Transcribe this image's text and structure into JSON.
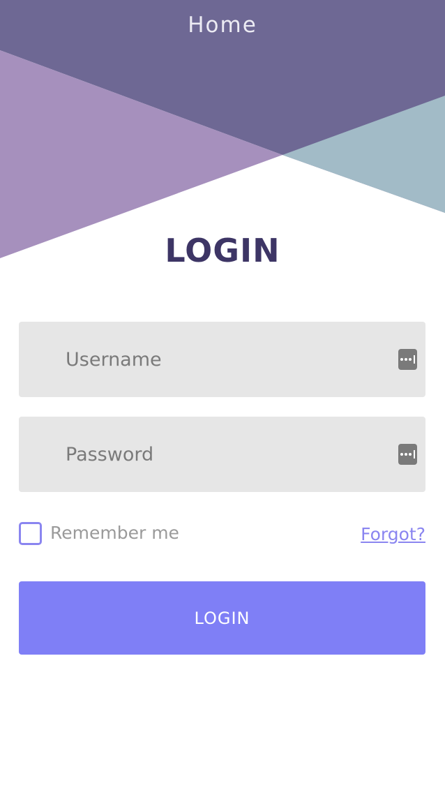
{
  "nav": {
    "title": "Home"
  },
  "page": {
    "title": "LOGIN"
  },
  "form": {
    "username": {
      "value": "",
      "placeholder": "Username",
      "icon": "password-manager-icon"
    },
    "password": {
      "value": "",
      "placeholder": "Password",
      "icon": "password-manager-icon"
    },
    "remember_label": "Remember me",
    "remember_checked": false,
    "forgot_label": "Forgot?",
    "submit_label": "LOGIN"
  },
  "colors": {
    "header_dark": "#6e6894",
    "header_purple": "#a690bd",
    "header_teal": "#a2bbc7",
    "title": "#3d3565",
    "field_bg": "#e6e6e6",
    "accent": "#7f7ff6",
    "link": "#8a85f0"
  }
}
